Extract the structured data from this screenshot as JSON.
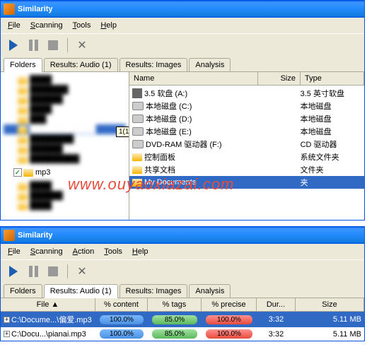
{
  "watermark": "www.ouyaoxiazai.com",
  "window1": {
    "title": "Similarity",
    "menu": {
      "file": "File",
      "scanning": "Scanning",
      "tools": "Tools",
      "help": "Help"
    },
    "tabs": {
      "folders": "Folders",
      "results_audio": "Results: Audio (1)",
      "results_images": "Results: Images",
      "analysis": "Analysis"
    },
    "tooltip": "1(1)",
    "tree_selected": "mp3",
    "list_headers": {
      "name": "Name",
      "size": "Size",
      "type": "Type"
    },
    "drives": [
      {
        "name": "3.5 软盘 (A:)",
        "type": "3.5 英寸软盘"
      },
      {
        "name": "本地磁盘 (C:)",
        "type": "本地磁盘"
      },
      {
        "name": "本地磁盘 (D:)",
        "type": "本地磁盘"
      },
      {
        "name": "本地磁盘 (E:)",
        "type": "本地磁盘"
      },
      {
        "name": "DVD-RAM 驱动器 (F:)",
        "type": "CD 驱动器"
      },
      {
        "name": "控制面板",
        "type": "系统文件夹"
      },
      {
        "name": "共享文档",
        "type": "文件夹"
      },
      {
        "name": "My Documents",
        "type": "夹"
      }
    ]
  },
  "window2": {
    "title": "Similarity",
    "menu": {
      "file": "File",
      "scanning": "Scanning",
      "action": "Action",
      "tools": "Tools",
      "help": "Help"
    },
    "tabs": {
      "folders": "Folders",
      "results_audio": "Results: Audio (1)",
      "results_images": "Results: Images",
      "analysis": "Analysis"
    },
    "headers": {
      "file": "File ▲",
      "content": "% content",
      "tags": "% tags",
      "precise": "% precise",
      "dur": "Dur...",
      "size": "Size"
    },
    "rows": [
      {
        "file": "C:\\Docume...\\偏爱.mp3",
        "content": "100.0%",
        "tags": "85.0%",
        "precise": "100.0%",
        "dur": "3:32",
        "size": "5.11 MB"
      },
      {
        "file": "C:\\Docu...\\pianai.mp3",
        "content": "100.0%",
        "tags": "85.0%",
        "precise": "100.0%",
        "dur": "3:32",
        "size": "5.11 MB"
      }
    ]
  }
}
